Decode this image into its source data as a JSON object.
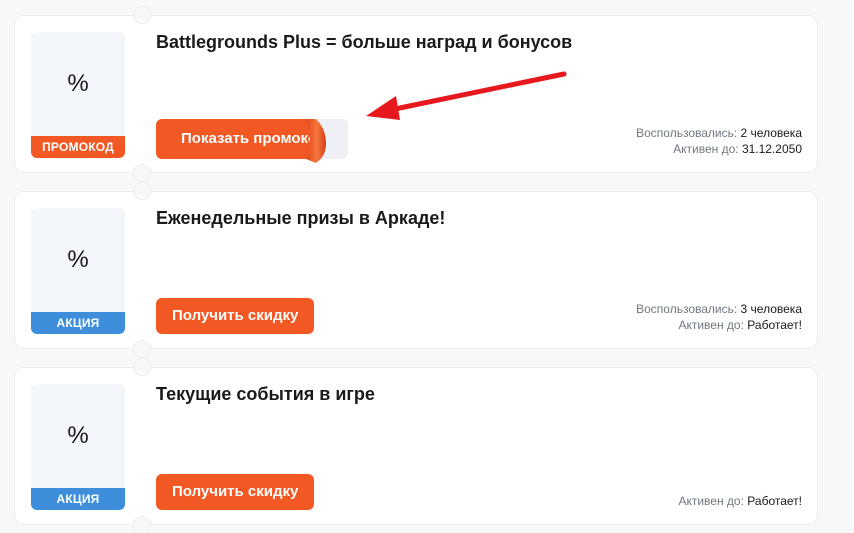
{
  "coupons": [
    {
      "percent_glyph": "%",
      "badge": "ПРОМОКОД",
      "title": "Battlegrounds Plus = больше наград и бонусов",
      "button_label": "Показать промокод",
      "used_label": "Воспользовались:",
      "used_value": "2 человека",
      "active_label": "Активен до:",
      "active_value": "31.12.2050"
    },
    {
      "percent_glyph": "%",
      "badge": "АКЦИЯ",
      "title": "Еженедельные призы в Аркаде!",
      "button_label": "Получить скидку",
      "used_label": "Воспользовались:",
      "used_value": "3 человека",
      "active_label": "Активен до:",
      "active_value": "Работает!"
    },
    {
      "percent_glyph": "%",
      "badge": "АКЦИЯ",
      "title": "Текущие события в игре",
      "button_label": "Получить скидку",
      "active_label": "Активен до:",
      "active_value": "Работает!"
    }
  ],
  "colors": {
    "accent": "#f25824",
    "deal_badge": "#3d8fdc",
    "annotation_arrow": "#e8191e"
  },
  "icons": {
    "annotation": "red-arrow-icon",
    "peel": "peel-corner-icon"
  }
}
